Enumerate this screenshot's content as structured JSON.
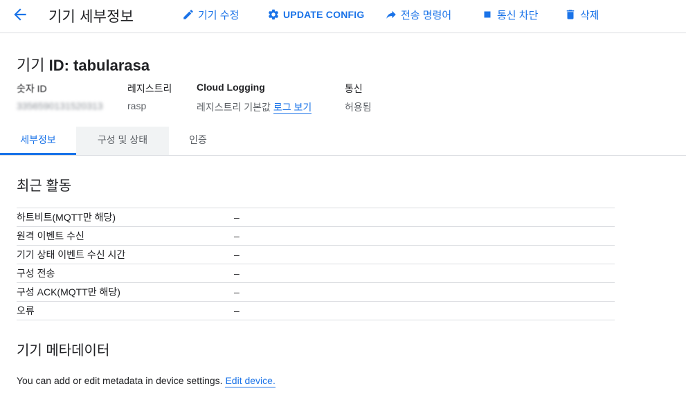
{
  "toolbar": {
    "title": "기기 세부정보",
    "actions": {
      "edit": "기기 수정",
      "update_config": "UPDATE CONFIG",
      "send_command": "전송 명령어",
      "block": "통신 차단",
      "delete": "삭제"
    }
  },
  "device": {
    "title_prefix": "기기 ",
    "title_id": "ID: tabularasa",
    "numeric_id_label": "숫자 ID",
    "numeric_id_value": "3356590131520313",
    "registry_label": "레지스트리",
    "registry_value": "rasp",
    "logging_label": "Cloud Logging",
    "logging_value": "레지스트리 기본값",
    "logging_link": "로그 보기",
    "comm_label": "통신",
    "comm_value": "허용됨"
  },
  "tabs": [
    {
      "label": "세부정보",
      "active": true
    },
    {
      "label": "구성 및 상태",
      "active": false
    },
    {
      "label": "인증",
      "active": false
    }
  ],
  "recent_activity": {
    "title": "최근 활동",
    "rows": [
      {
        "label": "하트비트(MQTT만 해당)",
        "value": "–"
      },
      {
        "label": "원격 이벤트 수신",
        "value": "–"
      },
      {
        "label": "기기 상태 이벤트 수신 시간",
        "value": "–"
      },
      {
        "label": "구성 전송",
        "value": "–"
      },
      {
        "label": "구성 ACK(MQTT만 해당)",
        "value": "–"
      },
      {
        "label": "오류",
        "value": "–"
      }
    ]
  },
  "metadata": {
    "title": "기기 메타데이터",
    "text": "You can add or edit metadata in device settings. ",
    "link": "Edit device."
  },
  "colors": {
    "accent": "#1a73e8",
    "text": "#202124",
    "muted": "#5f6368",
    "divider": "#dadce0"
  }
}
